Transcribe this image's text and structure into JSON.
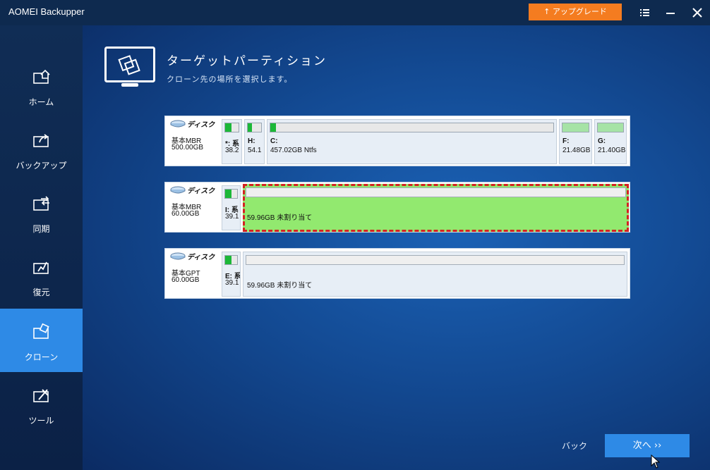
{
  "app": {
    "title": "AOMEI Backupper",
    "upgrade_label": "アップグレード"
  },
  "window_controls": [
    "menu-icon",
    "minimize-icon",
    "close-icon"
  ],
  "sidebar": {
    "items": [
      {
        "label": "ホーム",
        "icon": "home-icon",
        "active": false
      },
      {
        "label": "バックアップ",
        "icon": "backup-icon",
        "active": false
      },
      {
        "label": "同期",
        "icon": "sync-icon",
        "active": false
      },
      {
        "label": "復元",
        "icon": "restore-icon",
        "active": false
      },
      {
        "label": "クローン",
        "icon": "clone-icon",
        "active": true
      },
      {
        "label": "ツール",
        "icon": "tools-icon",
        "active": false
      }
    ]
  },
  "header": {
    "title": "ターゲットパーティション",
    "subtitle": "クローン先の場所を選択します。"
  },
  "disks": [
    {
      "label": "ディスク",
      "type": "基本MBR",
      "size": "500.00GB",
      "partitions": [
        {
          "name": "*: 系",
          "size": "38.2",
          "used": 0.45
        },
        {
          "name": "H:",
          "size": "54.1",
          "used": 0.08
        },
        {
          "name": "C:",
          "size": "457.02GB Ntfs",
          "used": 0.02
        },
        {
          "name": "F:",
          "size": "21.48GB",
          "used": 0.0
        },
        {
          "name": "G:",
          "size": "21.40GB",
          "used": 0.0
        }
      ]
    },
    {
      "label": "ディスク",
      "type": "基本MBR",
      "size": "60.00GB",
      "partitions": [
        {
          "name": "I: 系",
          "size": "39.1",
          "used": 0.5
        }
      ],
      "unallocated": {
        "label": "59.96GB 未割り当て",
        "selected": true
      }
    },
    {
      "label": "ディスク",
      "type": "基本GPT",
      "size": "60.00GB",
      "partitions": [
        {
          "name": "E: 系",
          "size": "39.1",
          "used": 0.5
        }
      ],
      "unallocated": {
        "label": "59.96GB 未割り当て",
        "selected": false
      }
    }
  ],
  "footer": {
    "back_label": "バック",
    "next_label": "次へ ››"
  },
  "colors": {
    "accent": "#2e8ae6",
    "upgrade": "#f47c20",
    "selected_fill": "#92e96f",
    "selected_border": "#d42222",
    "used_fill": "#1cb838"
  }
}
